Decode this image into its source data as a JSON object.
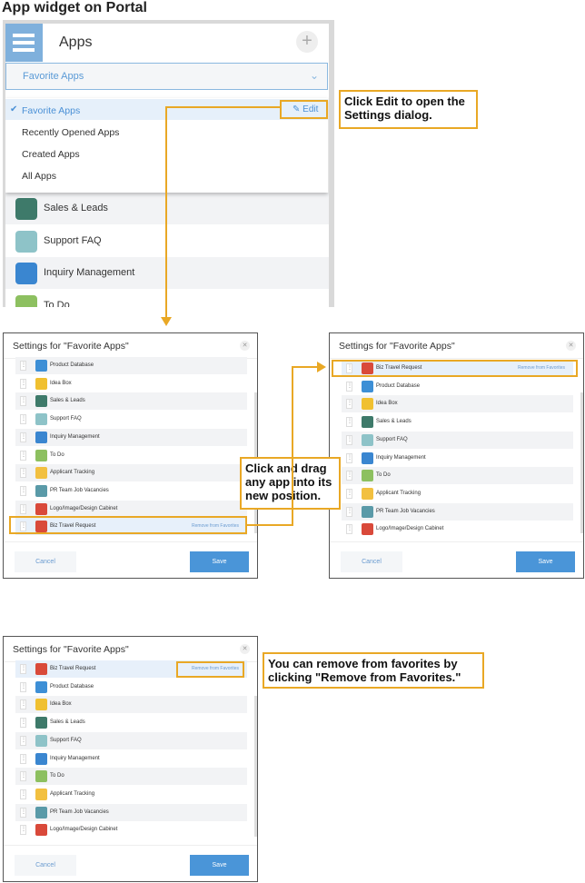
{
  "heading": "App widget on Portal",
  "widget": {
    "title": "Apps",
    "add_icon": "plus-icon",
    "selected_view": "Favorite Apps",
    "menu": [
      {
        "label": "Favorite Apps",
        "selected": true
      },
      {
        "label": "Recently Opened Apps"
      },
      {
        "label": "Created Apps"
      },
      {
        "label": "All Apps"
      }
    ],
    "edit_label": "Edit",
    "apps": [
      {
        "name": "Sales & Leads",
        "color": "#3e7a6a"
      },
      {
        "name": "Support FAQ",
        "color": "#8ec3c8"
      },
      {
        "name": "Inquiry Management",
        "color": "#3a86d0"
      },
      {
        "name": "To Do",
        "color": "#8dc060"
      }
    ]
  },
  "dialog": {
    "title": "Settings for \"Favorite Apps\"",
    "cancel": "Cancel",
    "save": "Save",
    "remove": "Remove from Favorites",
    "apps": {
      "biz": {
        "name": "Biz Travel Request",
        "color": "#d94a3a"
      },
      "prod": {
        "name": "Product Database",
        "color": "#3d8fd6"
      },
      "idea": {
        "name": "Idea Box",
        "color": "#f0c030"
      },
      "sales": {
        "name": "Sales & Leads",
        "color": "#3e7a6a"
      },
      "faq": {
        "name": "Support FAQ",
        "color": "#8ec3c8"
      },
      "inq": {
        "name": "Inquiry Management",
        "color": "#3a86d0"
      },
      "todo": {
        "name": "To Do",
        "color": "#8dc060"
      },
      "appl": {
        "name": "Applicant Tracking",
        "color": "#f2c040"
      },
      "pr": {
        "name": "PR Team Job Vacancies",
        "color": "#5a9aa8"
      },
      "logo": {
        "name": "Logo/Image/Design Cabinet",
        "color": "#d9493a"
      }
    },
    "orders": [
      [
        "prod",
        "idea",
        "sales",
        "faq",
        "inq",
        "todo",
        "appl",
        "pr",
        "logo",
        "biz"
      ],
      [
        "biz",
        "prod",
        "idea",
        "sales",
        "faq",
        "inq",
        "todo",
        "appl",
        "pr",
        "logo"
      ],
      [
        "biz",
        "prod",
        "idea",
        "sales",
        "faq",
        "inq",
        "todo",
        "appl",
        "pr",
        "logo"
      ]
    ]
  },
  "callouts": {
    "edit": "Click Edit to open the Settings dialog.",
    "drag": "Click and drag any app into its new position.",
    "remove": "You can remove from favorites by clicking \"Remove from Favorites.\""
  },
  "accent": "#e9a825"
}
